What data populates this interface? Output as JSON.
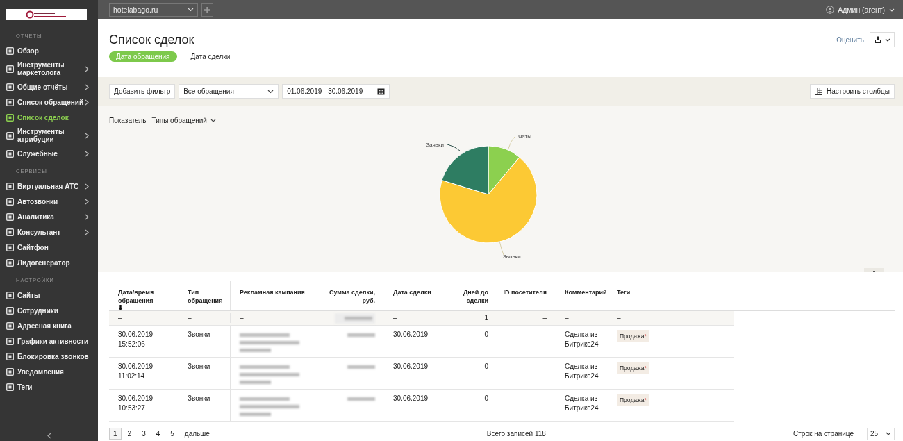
{
  "sidebar": {
    "sections": [
      {
        "title": "ОТЧЕТЫ",
        "items": [
          {
            "label": "Обзор",
            "selected": false,
            "has_submenu": false
          },
          {
            "label": "Инструменты маркетолога",
            "selected": false,
            "has_submenu": true
          },
          {
            "label": "Общие отчёты",
            "selected": false,
            "has_submenu": true
          },
          {
            "label": "Список обращений",
            "selected": false,
            "has_submenu": true
          },
          {
            "label": "Список сделок",
            "selected": true,
            "has_submenu": false
          },
          {
            "label": "Инструменты атрибуции",
            "selected": false,
            "has_submenu": true
          },
          {
            "label": "Служебные",
            "selected": false,
            "has_submenu": true
          }
        ]
      },
      {
        "title": "СЕРВИСЫ",
        "items": [
          {
            "label": "Виртуальная АТС",
            "selected": false,
            "has_submenu": true
          },
          {
            "label": "Автозвонки",
            "selected": false,
            "has_submenu": true
          },
          {
            "label": "Аналитика",
            "selected": false,
            "has_submenu": true
          },
          {
            "label": "Консультант",
            "selected": false,
            "has_submenu": true
          },
          {
            "label": "Сайтфон",
            "selected": false,
            "has_submenu": false
          },
          {
            "label": "Лидогенератор",
            "selected": false,
            "has_submenu": false
          }
        ]
      },
      {
        "title": "НАСТРОЙКИ",
        "items": [
          {
            "label": "Сайты",
            "selected": false,
            "has_submenu": false
          },
          {
            "label": "Сотрудники",
            "selected": false,
            "has_submenu": false
          },
          {
            "label": "Адресная книга",
            "selected": false,
            "has_submenu": false
          },
          {
            "label": "Графики активности",
            "selected": false,
            "has_submenu": false
          },
          {
            "label": "Блокировка звонков",
            "selected": false,
            "has_submenu": false
          },
          {
            "label": "Уведомления",
            "selected": false,
            "has_submenu": false
          },
          {
            "label": "Теги",
            "selected": false,
            "has_submenu": false
          }
        ]
      }
    ]
  },
  "topbar": {
    "site": "hotelabago.ru",
    "user": "Админ (агент)"
  },
  "header": {
    "title": "Список сделок",
    "rate_link": "Оценить",
    "tabs": [
      {
        "label": "Дата обращения",
        "selected": true
      },
      {
        "label": "Дата сделки",
        "selected": false
      }
    ]
  },
  "filters": {
    "add_filter": "Добавить фильтр",
    "type_select": "Все обращения",
    "date_range": "01.06.2019 - 30.06.2019",
    "columns_button": "Настроить столбцы"
  },
  "chart": {
    "indicator_label": "Показатель",
    "indicator_value": "Типы обращений",
    "slices": [
      {
        "label": "Чаты",
        "color": "#8cd04f"
      },
      {
        "label": "Звонки",
        "color": "#fcc934"
      },
      {
        "label": "Заявки",
        "color": "#2e7d62"
      }
    ]
  },
  "table": {
    "columns": [
      {
        "label": "Дата/время обращения",
        "sorted": true
      },
      {
        "label": "Тип обращения",
        "sorted": false
      },
      {
        "label": "Рекламная кампания",
        "sorted": false
      },
      {
        "label": "Сумма сделки, руб.",
        "sorted": false
      },
      {
        "label": "Дата сделки",
        "sorted": false
      },
      {
        "label": "Дней до сделки",
        "sorted": false
      },
      {
        "label": "ID посетителя",
        "sorted": false
      },
      {
        "label": "Комментарий",
        "sorted": false
      },
      {
        "label": "Теги",
        "sorted": false
      }
    ],
    "summary": {
      "datetime": "–",
      "type": "–",
      "campaign": "–",
      "deal_date": "–",
      "days": "1",
      "visitor_id": "–",
      "comment": "–",
      "tags": "–"
    },
    "rows": [
      {
        "datetime": "30.06.2019 15:52:06",
        "type": "Звонки",
        "deal_date": "30.06.2019",
        "days": "0",
        "visitor_id": "–",
        "comment": "Сделка из Битрикс24",
        "tag": "Продажа",
        "tag_mark": "*"
      },
      {
        "datetime": "30.06.2019 11:02:14",
        "type": "Звонки",
        "deal_date": "30.06.2019",
        "days": "0",
        "visitor_id": "–",
        "comment": "Сделка из Битрикс24",
        "tag": "Продажа",
        "tag_mark": "*"
      },
      {
        "datetime": "30.06.2019 10:53:27",
        "type": "Звонки",
        "deal_date": "30.06.2019",
        "days": "0",
        "visitor_id": "–",
        "comment": "Сделка из Битрикс24",
        "tag": "Продажа",
        "tag_mark": "*"
      }
    ]
  },
  "pagination": {
    "pages": [
      {
        "label": "1",
        "selected": true
      },
      {
        "label": "2",
        "selected": false
      },
      {
        "label": "3",
        "selected": false
      },
      {
        "label": "4",
        "selected": false
      },
      {
        "label": "5",
        "selected": false
      }
    ],
    "next": "дальше",
    "total": "Всего записей 118",
    "per_page_label": "Строк на странице",
    "per_page": "25"
  }
}
